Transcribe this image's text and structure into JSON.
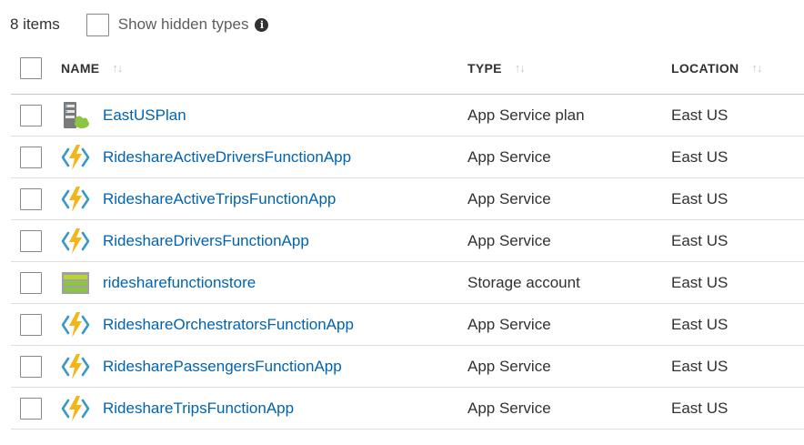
{
  "toolbar": {
    "count": "8 items",
    "show_hidden_label": "Show hidden types"
  },
  "columns": {
    "name": "NAME",
    "type": "TYPE",
    "location": "LOCATION"
  },
  "rows": [
    {
      "name": "EastUSPlan",
      "type": "App Service plan",
      "location": "East US",
      "icon": "app-service-plan-icon"
    },
    {
      "name": "RideshareActiveDriversFunctionApp",
      "type": "App Service",
      "location": "East US",
      "icon": "function-app-icon"
    },
    {
      "name": "RideshareActiveTripsFunctionApp",
      "type": "App Service",
      "location": "East US",
      "icon": "function-app-icon"
    },
    {
      "name": "RideshareDriversFunctionApp",
      "type": "App Service",
      "location": "East US",
      "icon": "function-app-icon"
    },
    {
      "name": "ridesharefunctionstore",
      "type": "Storage account",
      "location": "East US",
      "icon": "storage-account-icon"
    },
    {
      "name": "RideshareOrchestratorsFunctionApp",
      "type": "App Service",
      "location": "East US",
      "icon": "function-app-icon"
    },
    {
      "name": "RidesharePassengersFunctionApp",
      "type": "App Service",
      "location": "East US",
      "icon": "function-app-icon"
    },
    {
      "name": "RideshareTripsFunctionApp",
      "type": "App Service",
      "location": "East US",
      "icon": "function-app-icon"
    }
  ],
  "colors": {
    "link": "#0063b1",
    "function_bolt": "#f2b51a",
    "function_brackets": "#3999c6",
    "storage_green": "#8cc53f"
  }
}
